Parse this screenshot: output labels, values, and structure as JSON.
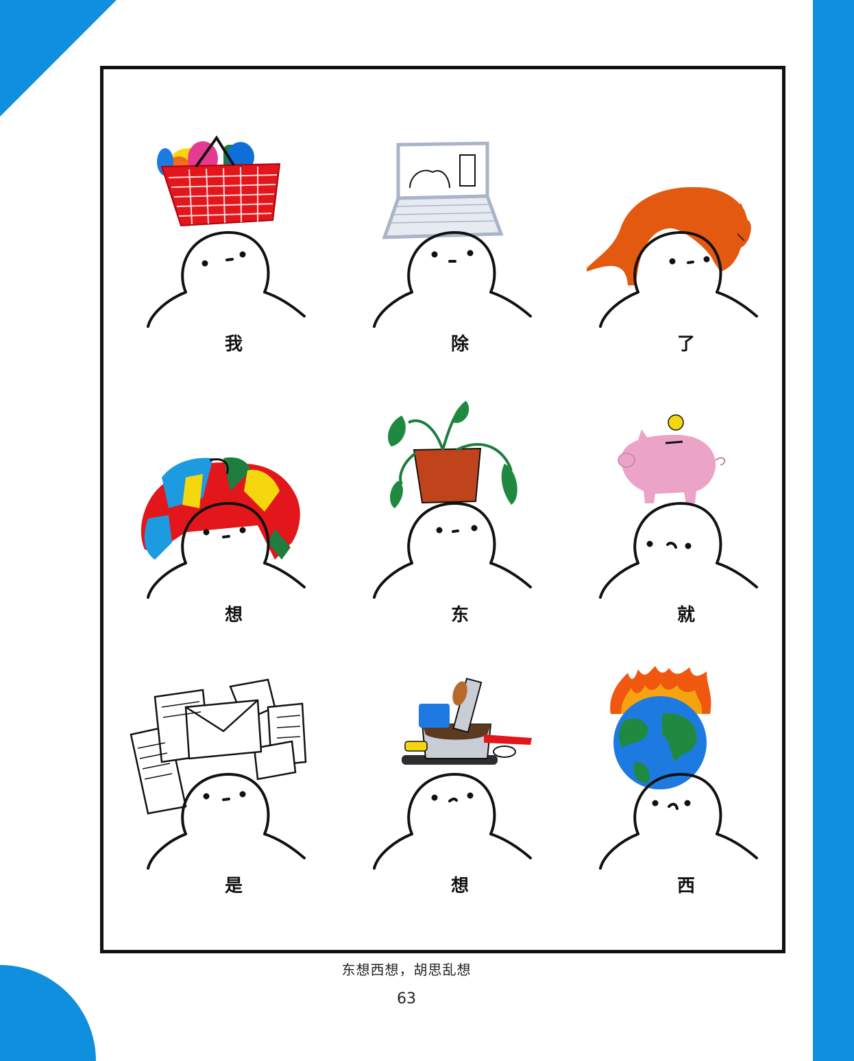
{
  "characters": [
    "我",
    "除",
    "了",
    "想",
    "东",
    "就",
    "是",
    "想",
    "西"
  ],
  "items": [
    "basket-icon",
    "laptop-icon",
    "cat-icon",
    "clothes-pile-icon",
    "potted-plant-icon",
    "piggy-bank-icon",
    "papers-icon",
    "dishes-icon",
    "burning-earth-icon"
  ],
  "caption": "东想西想，胡思乱想",
  "page_number": "63",
  "colors": {
    "accent_blue": "#0f8fde",
    "frame": "#111111"
  }
}
